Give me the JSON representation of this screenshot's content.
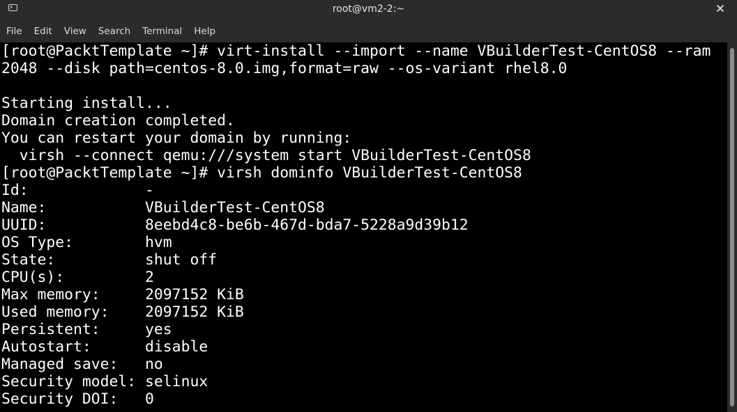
{
  "window": {
    "title": "root@vm2-2:~"
  },
  "menu": {
    "items": [
      "File",
      "Edit",
      "View",
      "Search",
      "Terminal",
      "Help"
    ]
  },
  "terminal": {
    "lines": [
      "[root@PacktTemplate ~]# virt-install --import --name VBuilderTest-CentOS8 --ram",
      "2048 --disk path=centos-8.0.img,format=raw --os-variant rhel8.0",
      "",
      "Starting install...",
      "Domain creation completed.",
      "You can restart your domain by running:",
      "  virsh --connect qemu:///system start VBuilderTest-CentOS8",
      "[root@PacktTemplate ~]# virsh dominfo VBuilderTest-CentOS8",
      "Id:             -",
      "Name:           VBuilderTest-CentOS8",
      "UUID:           8eebd4c8-be6b-467d-bda7-5228a9d39b12",
      "OS Type:        hvm",
      "State:          shut off",
      "CPU(s):         2",
      "Max memory:     2097152 KiB",
      "Used memory:    2097152 KiB",
      "Persistent:     yes",
      "Autostart:      disable",
      "Managed save:   no",
      "Security model: selinux",
      "Security DOI:   0"
    ]
  },
  "colors": {
    "chrome_bg": "#2b2b2b",
    "terminal_bg": "#000000",
    "terminal_fg": "#ffffff",
    "chrome_text": "#e6e6e6"
  },
  "icons": {
    "app": "terminal-icon",
    "close": "close-icon"
  }
}
